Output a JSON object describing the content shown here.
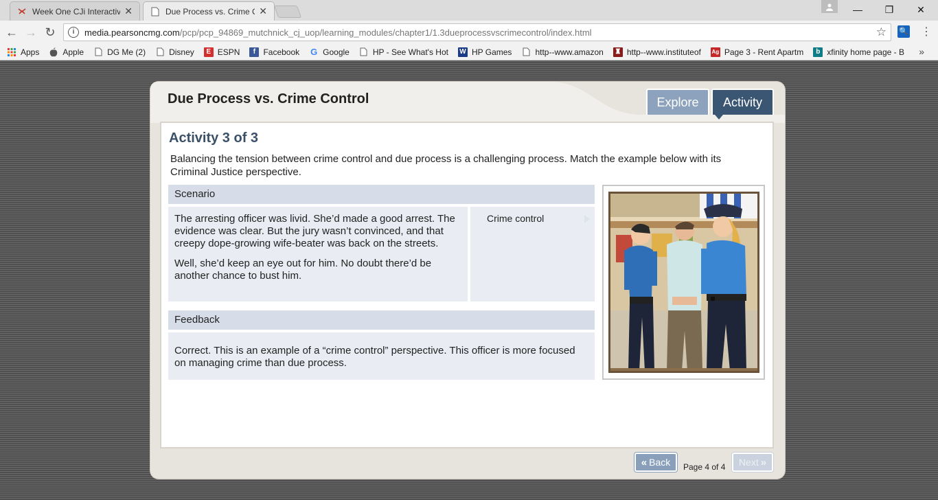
{
  "browser": {
    "tabs": [
      {
        "title": "Week One CJi Interactive",
        "active": false
      },
      {
        "title": "Due Process vs. Crime Co",
        "active": true
      }
    ],
    "url_host": "media.pearsoncmg.com",
    "url_path": "/pcp/pcp_94869_mutchnick_cj_uop/learning_modules/chapter1/1.3dueprocessvscrimecontrol/index.html",
    "bookmarks": [
      {
        "label": "Apps",
        "icon": "apps-grid-icon",
        "color": "#e53935"
      },
      {
        "label": "Apple",
        "icon": "apple-icon",
        "color": "#555555"
      },
      {
        "label": "DG Me (2)",
        "icon": "page-icon",
        "color": "#777777"
      },
      {
        "label": "Disney",
        "icon": "page-icon",
        "color": "#777777"
      },
      {
        "label": "ESPN",
        "icon": "espn-icon",
        "color": "#d32f2f"
      },
      {
        "label": "Facebook",
        "icon": "facebook-icon",
        "color": "#3b5998"
      },
      {
        "label": "Google",
        "icon": "google-icon",
        "color": "#4285f4"
      },
      {
        "label": "HP - See What's Hot",
        "icon": "page-icon",
        "color": "#777777"
      },
      {
        "label": "HP Games",
        "icon": "wgames-icon",
        "color": "#1a3a8a"
      },
      {
        "label": "http--www.amazon",
        "icon": "page-icon",
        "color": "#777777"
      },
      {
        "label": "http--www.instituteof",
        "icon": "crest-icon",
        "color": "#8b1a1a"
      },
      {
        "label": "Page 3 - Rent Apartm",
        "icon": "ag-icon",
        "color": "#c62828"
      },
      {
        "label": "xfinity home page - B",
        "icon": "bing-icon",
        "color": "#0e7c86"
      }
    ],
    "more": "»"
  },
  "module": {
    "title": "Due Process vs. Crime Control",
    "tabs": {
      "explore": "Explore",
      "activity": "Activity"
    },
    "activity_heading": "Activity 3 of 3",
    "instructions": "Balancing the tension between crime control and due process is a challenging process. Match the example below with its Criminal Justice perspective.",
    "scenario_label": "Scenario",
    "scenario_p1": "The arresting officer was livid. She’d made a good arrest. The evidence was clear. But the jury wasn’t convinced, and that creepy dope-growing wife-beater was back on the streets.",
    "scenario_p2": "Well, she’d keep an eye out for him. No doubt there’d be another chance to bust him.",
    "answer": "Crime control",
    "feedback_label": "Feedback",
    "feedback": "Correct. This is an example of a “crime control” perspective. This officer is more focused on managing crime than due process.",
    "back_label": "Back",
    "next_label": "Next",
    "page_indicator": "Page 4 of 4"
  }
}
